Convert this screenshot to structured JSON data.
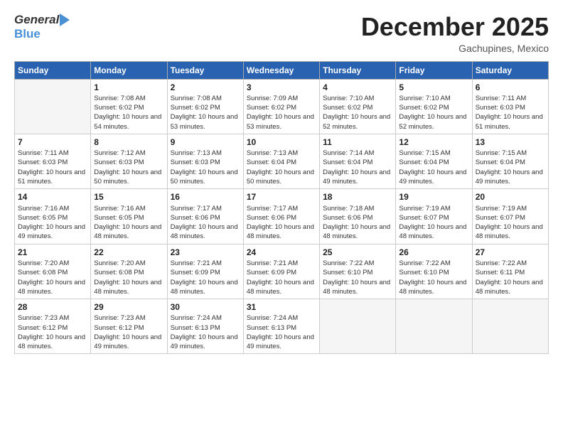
{
  "header": {
    "logo_general": "General",
    "logo_blue": "Blue",
    "month_title": "December 2025",
    "location": "Gachupines, Mexico"
  },
  "days_of_week": [
    "Sunday",
    "Monday",
    "Tuesday",
    "Wednesday",
    "Thursday",
    "Friday",
    "Saturday"
  ],
  "weeks": [
    [
      {
        "day": "",
        "empty": true
      },
      {
        "day": "1",
        "sunrise": "Sunrise: 7:08 AM",
        "sunset": "Sunset: 6:02 PM",
        "daylight": "Daylight: 10 hours and 54 minutes."
      },
      {
        "day": "2",
        "sunrise": "Sunrise: 7:08 AM",
        "sunset": "Sunset: 6:02 PM",
        "daylight": "Daylight: 10 hours and 53 minutes."
      },
      {
        "day": "3",
        "sunrise": "Sunrise: 7:09 AM",
        "sunset": "Sunset: 6:02 PM",
        "daylight": "Daylight: 10 hours and 53 minutes."
      },
      {
        "day": "4",
        "sunrise": "Sunrise: 7:10 AM",
        "sunset": "Sunset: 6:02 PM",
        "daylight": "Daylight: 10 hours and 52 minutes."
      },
      {
        "day": "5",
        "sunrise": "Sunrise: 7:10 AM",
        "sunset": "Sunset: 6:02 PM",
        "daylight": "Daylight: 10 hours and 52 minutes."
      },
      {
        "day": "6",
        "sunrise": "Sunrise: 7:11 AM",
        "sunset": "Sunset: 6:03 PM",
        "daylight": "Daylight: 10 hours and 51 minutes."
      }
    ],
    [
      {
        "day": "7",
        "sunrise": "Sunrise: 7:11 AM",
        "sunset": "Sunset: 6:03 PM",
        "daylight": "Daylight: 10 hours and 51 minutes."
      },
      {
        "day": "8",
        "sunrise": "Sunrise: 7:12 AM",
        "sunset": "Sunset: 6:03 PM",
        "daylight": "Daylight: 10 hours and 50 minutes."
      },
      {
        "day": "9",
        "sunrise": "Sunrise: 7:13 AM",
        "sunset": "Sunset: 6:03 PM",
        "daylight": "Daylight: 10 hours and 50 minutes."
      },
      {
        "day": "10",
        "sunrise": "Sunrise: 7:13 AM",
        "sunset": "Sunset: 6:04 PM",
        "daylight": "Daylight: 10 hours and 50 minutes."
      },
      {
        "day": "11",
        "sunrise": "Sunrise: 7:14 AM",
        "sunset": "Sunset: 6:04 PM",
        "daylight": "Daylight: 10 hours and 49 minutes."
      },
      {
        "day": "12",
        "sunrise": "Sunrise: 7:15 AM",
        "sunset": "Sunset: 6:04 PM",
        "daylight": "Daylight: 10 hours and 49 minutes."
      },
      {
        "day": "13",
        "sunrise": "Sunrise: 7:15 AM",
        "sunset": "Sunset: 6:04 PM",
        "daylight": "Daylight: 10 hours and 49 minutes."
      }
    ],
    [
      {
        "day": "14",
        "sunrise": "Sunrise: 7:16 AM",
        "sunset": "Sunset: 6:05 PM",
        "daylight": "Daylight: 10 hours and 49 minutes."
      },
      {
        "day": "15",
        "sunrise": "Sunrise: 7:16 AM",
        "sunset": "Sunset: 6:05 PM",
        "daylight": "Daylight: 10 hours and 48 minutes."
      },
      {
        "day": "16",
        "sunrise": "Sunrise: 7:17 AM",
        "sunset": "Sunset: 6:06 PM",
        "daylight": "Daylight: 10 hours and 48 minutes."
      },
      {
        "day": "17",
        "sunrise": "Sunrise: 7:17 AM",
        "sunset": "Sunset: 6:06 PM",
        "daylight": "Daylight: 10 hours and 48 minutes."
      },
      {
        "day": "18",
        "sunrise": "Sunrise: 7:18 AM",
        "sunset": "Sunset: 6:06 PM",
        "daylight": "Daylight: 10 hours and 48 minutes."
      },
      {
        "day": "19",
        "sunrise": "Sunrise: 7:19 AM",
        "sunset": "Sunset: 6:07 PM",
        "daylight": "Daylight: 10 hours and 48 minutes."
      },
      {
        "day": "20",
        "sunrise": "Sunrise: 7:19 AM",
        "sunset": "Sunset: 6:07 PM",
        "daylight": "Daylight: 10 hours and 48 minutes."
      }
    ],
    [
      {
        "day": "21",
        "sunrise": "Sunrise: 7:20 AM",
        "sunset": "Sunset: 6:08 PM",
        "daylight": "Daylight: 10 hours and 48 minutes."
      },
      {
        "day": "22",
        "sunrise": "Sunrise: 7:20 AM",
        "sunset": "Sunset: 6:08 PM",
        "daylight": "Daylight: 10 hours and 48 minutes."
      },
      {
        "day": "23",
        "sunrise": "Sunrise: 7:21 AM",
        "sunset": "Sunset: 6:09 PM",
        "daylight": "Daylight: 10 hours and 48 minutes."
      },
      {
        "day": "24",
        "sunrise": "Sunrise: 7:21 AM",
        "sunset": "Sunset: 6:09 PM",
        "daylight": "Daylight: 10 hours and 48 minutes."
      },
      {
        "day": "25",
        "sunrise": "Sunrise: 7:22 AM",
        "sunset": "Sunset: 6:10 PM",
        "daylight": "Daylight: 10 hours and 48 minutes."
      },
      {
        "day": "26",
        "sunrise": "Sunrise: 7:22 AM",
        "sunset": "Sunset: 6:10 PM",
        "daylight": "Daylight: 10 hours and 48 minutes."
      },
      {
        "day": "27",
        "sunrise": "Sunrise: 7:22 AM",
        "sunset": "Sunset: 6:11 PM",
        "daylight": "Daylight: 10 hours and 48 minutes."
      }
    ],
    [
      {
        "day": "28",
        "sunrise": "Sunrise: 7:23 AM",
        "sunset": "Sunset: 6:12 PM",
        "daylight": "Daylight: 10 hours and 48 minutes."
      },
      {
        "day": "29",
        "sunrise": "Sunrise: 7:23 AM",
        "sunset": "Sunset: 6:12 PM",
        "daylight": "Daylight: 10 hours and 49 minutes."
      },
      {
        "day": "30",
        "sunrise": "Sunrise: 7:24 AM",
        "sunset": "Sunset: 6:13 PM",
        "daylight": "Daylight: 10 hours and 49 minutes."
      },
      {
        "day": "31",
        "sunrise": "Sunrise: 7:24 AM",
        "sunset": "Sunset: 6:13 PM",
        "daylight": "Daylight: 10 hours and 49 minutes."
      },
      {
        "day": "",
        "empty": true
      },
      {
        "day": "",
        "empty": true
      },
      {
        "day": "",
        "empty": true
      }
    ]
  ]
}
